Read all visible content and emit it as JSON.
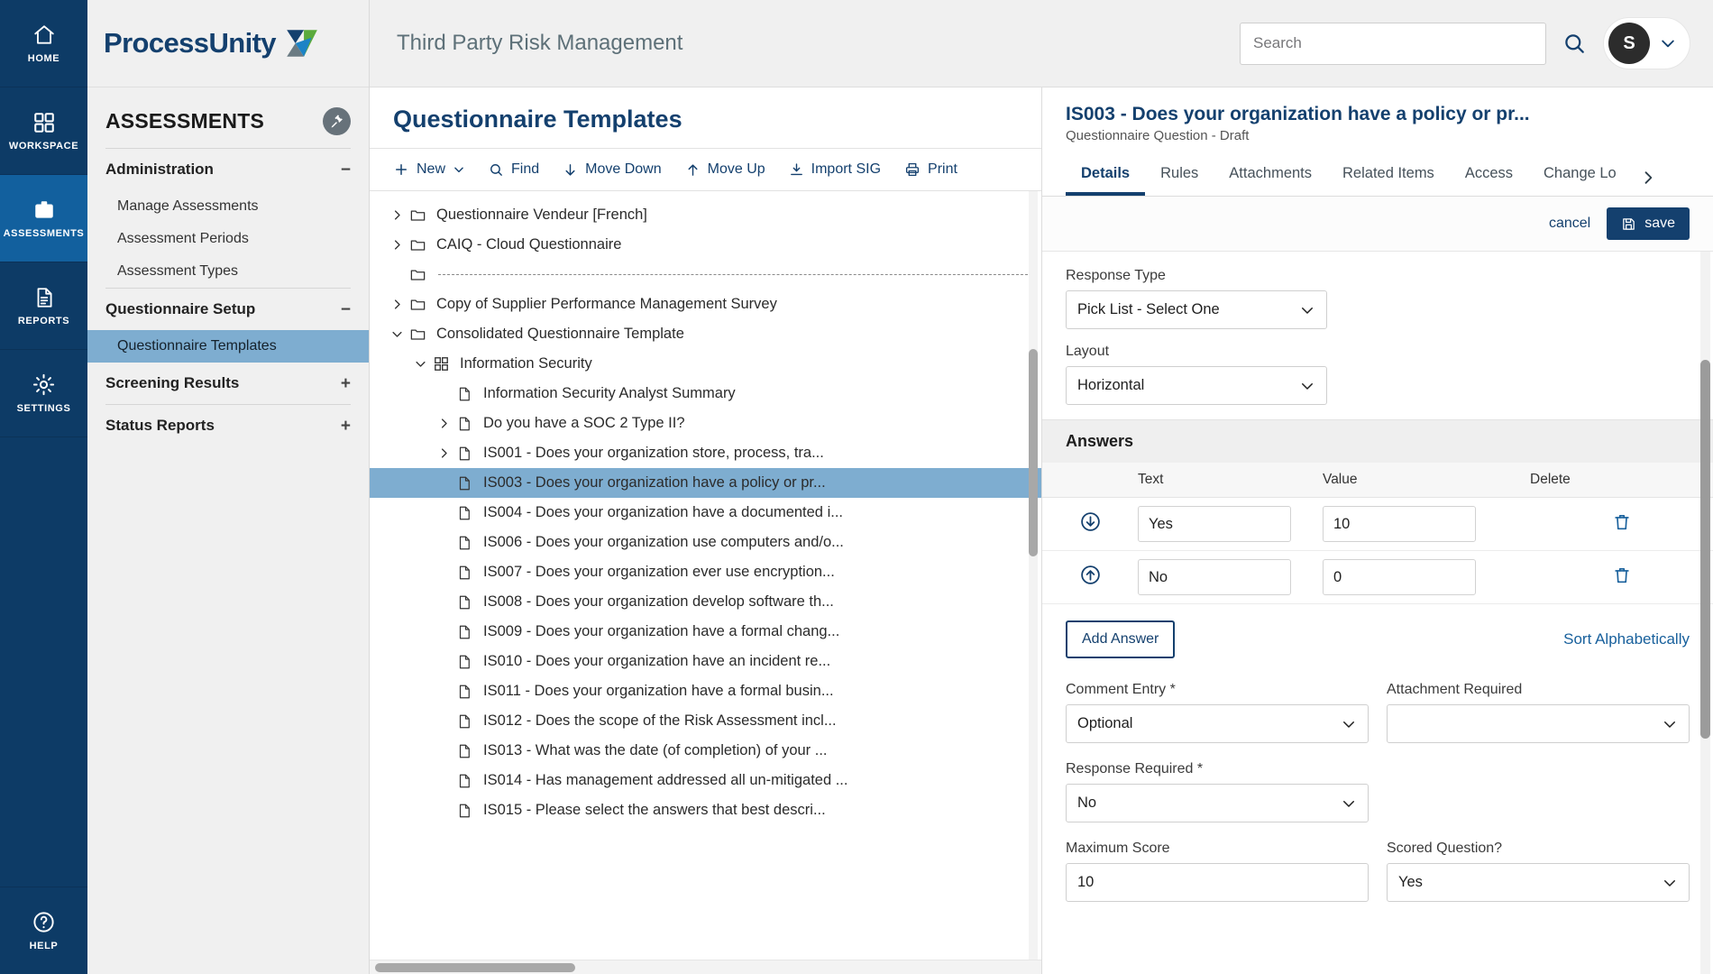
{
  "rail": {
    "items": [
      {
        "label": "HOME",
        "icon": "home-icon",
        "active": false
      },
      {
        "label": "WORKSPACE",
        "icon": "grid-icon",
        "active": false
      },
      {
        "label": "ASSESSMENTS",
        "icon": "clipboard-icon",
        "active": true
      },
      {
        "label": "REPORTS",
        "icon": "document-icon",
        "active": false
      },
      {
        "label": "SETTINGS",
        "icon": "gear-icon",
        "active": false
      }
    ],
    "help": {
      "label": "HELP",
      "icon": "question-circle-icon"
    }
  },
  "brand": {
    "name": "ProcessUnity",
    "logo": "processunity-logo-icon"
  },
  "sidebar": {
    "title": "ASSESSMENTS",
    "pin_icon": "pin-icon",
    "groups": [
      {
        "label": "Administration",
        "toggle": "−"
      },
      {
        "label": "Questionnaire Setup",
        "toggle": "−"
      },
      {
        "label": "Screening Results",
        "toggle": "+"
      },
      {
        "label": "Status Reports",
        "toggle": "+"
      }
    ],
    "admin_links": [
      "Manage Assessments",
      "Assessment Periods",
      "Assessment Types"
    ],
    "setup_links": [
      "Questionnaire Templates"
    ],
    "selected": "Questionnaire Templates"
  },
  "topbar": {
    "app_title": "Third Party Risk Management",
    "search_placeholder": "Search",
    "search_value": "",
    "search_icon": "search-icon",
    "avatar_initial": "S",
    "avatar_chevron": "chevron-down-icon"
  },
  "tree_panel": {
    "title": "Questionnaire Templates",
    "toolbar": [
      {
        "label": "New",
        "icon": "plus-icon",
        "caret": true
      },
      {
        "label": "Find",
        "icon": "search-icon",
        "caret": false
      },
      {
        "label": "Move Down",
        "icon": "arrow-down-icon",
        "caret": false
      },
      {
        "label": "Move Up",
        "icon": "arrow-up-icon",
        "caret": false
      },
      {
        "label": "Import SIG",
        "icon": "import-icon",
        "caret": false
      },
      {
        "label": "Print",
        "icon": "printer-icon",
        "caret": false
      }
    ],
    "rows": [
      {
        "label": "Questionnaire Vendeur [French]",
        "icon": "folder-icon",
        "twisty": "collapsed",
        "indent": 0,
        "selected": false,
        "dashed": false
      },
      {
        "label": "CAIQ - Cloud Questionnaire",
        "icon": "folder-icon",
        "twisty": "collapsed",
        "indent": 0,
        "selected": false,
        "dashed": false
      },
      {
        "label": "",
        "icon": "folder-icon",
        "twisty": "none",
        "indent": 0,
        "selected": false,
        "dashed": true
      },
      {
        "label": "Copy of Supplier Performance Management Survey",
        "icon": "folder-icon",
        "twisty": "collapsed",
        "indent": 0,
        "selected": false,
        "dashed": false
      },
      {
        "label": "Consolidated Questionnaire Template",
        "icon": "folder-icon",
        "twisty": "expanded",
        "indent": 0,
        "selected": false,
        "dashed": false
      },
      {
        "label": "Information Security",
        "icon": "section-grid-icon",
        "twisty": "expanded",
        "indent": 1,
        "selected": false,
        "dashed": false
      },
      {
        "label": "Information Security Analyst Summary",
        "icon": "file-icon",
        "twisty": "none",
        "indent": 2,
        "selected": false,
        "dashed": false
      },
      {
        "label": "Do you have a SOC 2 Type II?",
        "icon": "file-icon",
        "twisty": "collapsed",
        "indent": 2,
        "selected": false,
        "dashed": false
      },
      {
        "label": "IS001 - Does your organization store, process, tra...",
        "icon": "file-icon",
        "twisty": "collapsed",
        "indent": 2,
        "selected": false,
        "dashed": false
      },
      {
        "label": "IS003 - Does your organization have a policy or pr...",
        "icon": "file-icon",
        "twisty": "none",
        "indent": 2,
        "selected": true,
        "dashed": false
      },
      {
        "label": "IS004 - Does your organization have a documented i...",
        "icon": "file-icon",
        "twisty": "none",
        "indent": 2,
        "selected": false,
        "dashed": false
      },
      {
        "label": "IS006 - Does your organization use computers and/o...",
        "icon": "file-icon",
        "twisty": "none",
        "indent": 2,
        "selected": false,
        "dashed": false
      },
      {
        "label": "IS007 - Does your organization ever use encryption...",
        "icon": "file-icon",
        "twisty": "none",
        "indent": 2,
        "selected": false,
        "dashed": false
      },
      {
        "label": "IS008 - Does your organization develop software th...",
        "icon": "file-icon",
        "twisty": "none",
        "indent": 2,
        "selected": false,
        "dashed": false
      },
      {
        "label": "IS009 - Does your organization have a formal chang...",
        "icon": "file-icon",
        "twisty": "none",
        "indent": 2,
        "selected": false,
        "dashed": false
      },
      {
        "label": "IS010 - Does your organization have an incident re...",
        "icon": "file-icon",
        "twisty": "none",
        "indent": 2,
        "selected": false,
        "dashed": false
      },
      {
        "label": "IS011 - Does your organization have a formal busin...",
        "icon": "file-icon",
        "twisty": "none",
        "indent": 2,
        "selected": false,
        "dashed": false
      },
      {
        "label": "IS012 - Does the scope of the Risk Assessment incl...",
        "icon": "file-icon",
        "twisty": "none",
        "indent": 2,
        "selected": false,
        "dashed": false
      },
      {
        "label": "IS013 - What was the date (of completion) of your ...",
        "icon": "file-icon",
        "twisty": "none",
        "indent": 2,
        "selected": false,
        "dashed": false
      },
      {
        "label": "IS014 - Has management addressed all un-mitigated ...",
        "icon": "file-icon",
        "twisty": "none",
        "indent": 2,
        "selected": false,
        "dashed": false
      },
      {
        "label": "IS015 - Please select the answers that best descri...",
        "icon": "file-icon",
        "twisty": "none",
        "indent": 2,
        "selected": false,
        "dashed": false
      }
    ]
  },
  "detail": {
    "title": "IS003 - Does your organization have a policy or pr...",
    "subtitle": "Questionnaire Question - Draft",
    "tabs": [
      {
        "label": "Details",
        "active": true
      },
      {
        "label": "Rules",
        "active": false
      },
      {
        "label": "Attachments",
        "active": false
      },
      {
        "label": "Related Items",
        "active": false
      },
      {
        "label": "Access",
        "active": false
      },
      {
        "label": "Change Lo",
        "active": false
      }
    ],
    "tab_more_icon": "chevron-right-icon",
    "actions": {
      "cancel_label": "cancel",
      "save_label": "save",
      "save_icon": "save-disk-icon"
    },
    "fields": {
      "response_type": {
        "label": "Response Type",
        "value": "Pick List - Select One"
      },
      "layout": {
        "label": "Layout",
        "value": "Horizontal"
      },
      "comment_entry": {
        "label": "Comment Entry *",
        "value": "Optional"
      },
      "attachment_required": {
        "label": "Attachment Required",
        "value": ""
      },
      "response_required": {
        "label": "Response Required *",
        "value": "No"
      },
      "maximum_score": {
        "label": "Maximum Score",
        "value": "10"
      },
      "scored_question": {
        "label": "Scored Question?",
        "value": "Yes"
      }
    },
    "answers": {
      "section_title": "Answers",
      "columns": [
        "",
        "Text",
        "Value",
        "Delete"
      ],
      "rows": [
        {
          "move_icon": "circle-arrow-down-icon",
          "text": "Yes",
          "value": "10",
          "delete_icon": "trash-icon"
        },
        {
          "move_icon": "circle-arrow-up-icon",
          "text": "No",
          "value": "0",
          "delete_icon": "trash-icon"
        }
      ],
      "add_label": "Add Answer",
      "sort_label": "Sort Alphabetically"
    }
  },
  "colors": {
    "rail_bg": "#0d3b66",
    "rail_active": "#12609e",
    "brand_blue": "#14406e",
    "selection_blue": "#7eadd0",
    "link_blue": "#18609c"
  }
}
